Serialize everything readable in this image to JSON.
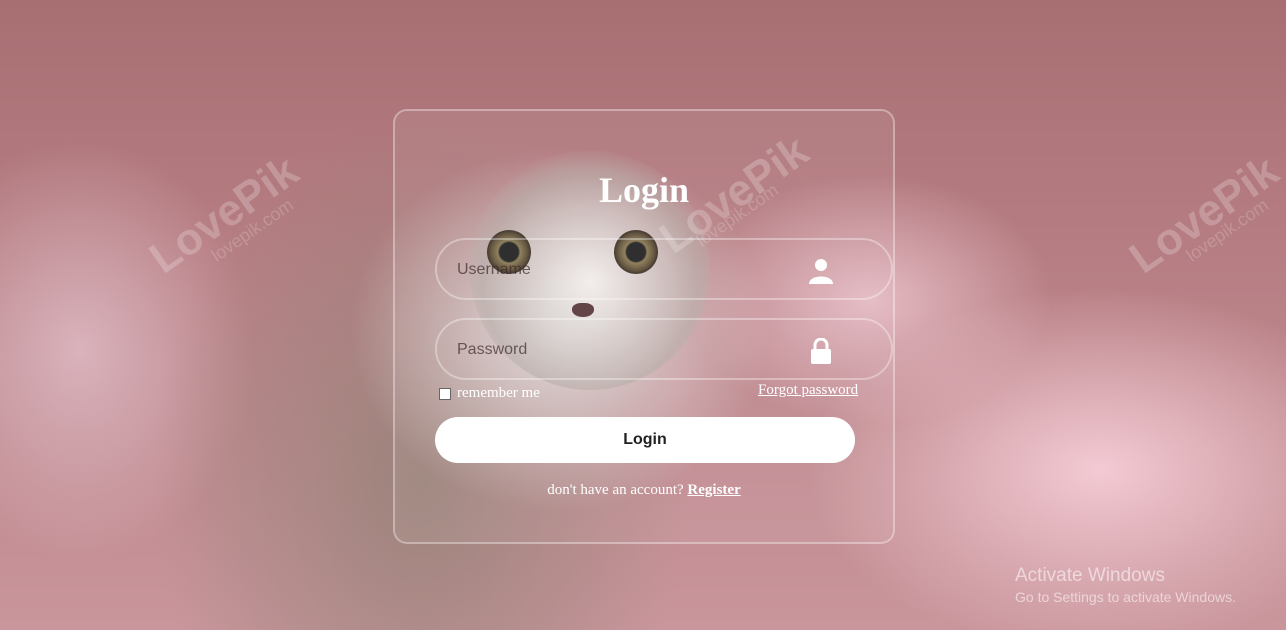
{
  "background": {
    "watermark": "LovePik",
    "watermark_sub": "lovepik.com"
  },
  "login": {
    "title": "Login",
    "username": {
      "value": "",
      "placeholder": "Username",
      "icon": "user-icon"
    },
    "password": {
      "value": "",
      "placeholder": "Password",
      "icon": "lock-icon"
    },
    "remember_label": "remember me",
    "remember_checked": false,
    "forgot_label": "Forgot password",
    "submit_label": "Login",
    "register_prompt": "don't have an account?",
    "register_label": "Register"
  },
  "os_overlay": {
    "activate_title": "Activate Windows",
    "activate_subtitle": "Go to Settings to activate Windows."
  },
  "colors": {
    "card_border": "#ffffff",
    "button_bg": "#ffffff",
    "text": "#ffffff"
  }
}
